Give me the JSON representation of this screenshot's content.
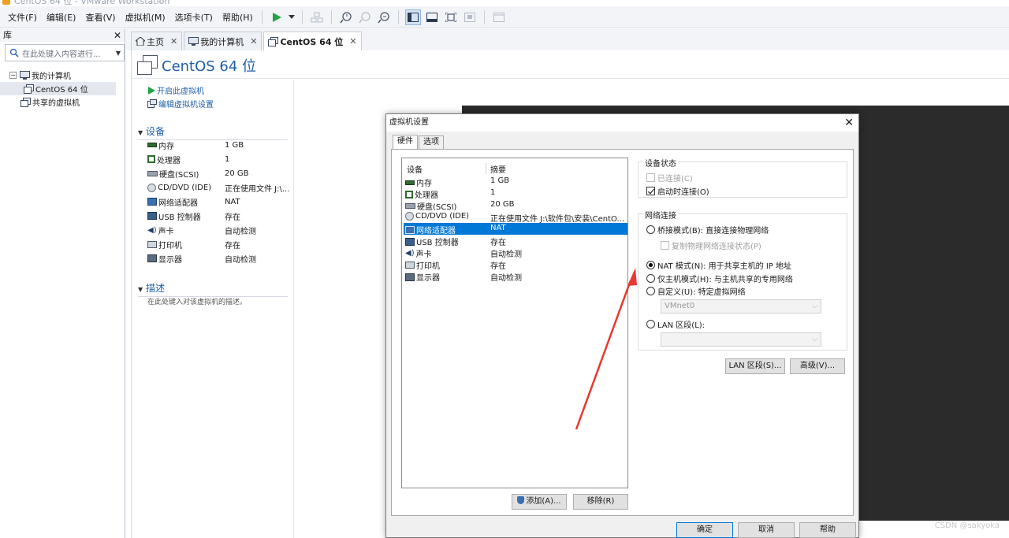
{
  "window": {
    "title": "CentOS 64 位 - VMware Workstation"
  },
  "menu": [
    "文件(F)",
    "编辑(E)",
    "查看(V)",
    "虚拟机(M)",
    "选项卡(T)",
    "帮助(H)"
  ],
  "library": {
    "header": "库",
    "search_placeholder": "在此处键入内容进行...",
    "tree": {
      "root": "我的计算机",
      "vm": "CentOS 64 位",
      "shared": "共享的虚拟机"
    }
  },
  "tabs": [
    {
      "label": "主页"
    },
    {
      "label": "我的计算机"
    },
    {
      "label": "CentOS 64 位"
    }
  ],
  "vm": {
    "title": "CentOS 64 位",
    "actions": {
      "power_on": "开启此虚拟机",
      "edit": "编辑虚拟机设置"
    },
    "devices_header": "设备",
    "devices": [
      {
        "name": "内存",
        "value": "1 GB",
        "icon": "memory-icon"
      },
      {
        "name": "处理器",
        "value": "1",
        "icon": "cpu-icon"
      },
      {
        "name": "硬盘(SCSI)",
        "value": "20 GB",
        "icon": "disk-icon"
      },
      {
        "name": "CD/DVD (IDE)",
        "value": "正在使用文件 J:\\...",
        "icon": "cd-icon"
      },
      {
        "name": "网络适配器",
        "value": "NAT",
        "icon": "network-icon"
      },
      {
        "name": "USB 控制器",
        "value": "存在",
        "icon": "usb-icon"
      },
      {
        "name": "声卡",
        "value": "自动检测",
        "icon": "sound-icon"
      },
      {
        "name": "打印机",
        "value": "存在",
        "icon": "printer-icon"
      },
      {
        "name": "显示器",
        "value": "自动检测",
        "icon": "display-icon"
      }
    ],
    "description_header": "描述",
    "description_placeholder": "在此处键入对该虚拟机的描述。"
  },
  "dialog": {
    "title": "虚拟机设置",
    "tabs": [
      "硬件",
      "选项"
    ],
    "list_headers": {
      "device": "设备",
      "summary": "摘要"
    },
    "list": [
      {
        "name": "内存",
        "value": "1 GB"
      },
      {
        "name": "处理器",
        "value": "1"
      },
      {
        "name": "硬盘(SCSI)",
        "value": "20 GB"
      },
      {
        "name": "CD/DVD (IDE)",
        "value": "正在使用文件 J:\\软件包\\安装\\CentO..."
      },
      {
        "name": "网络适配器",
        "value": "NAT",
        "selected": true
      },
      {
        "name": "USB 控制器",
        "value": "存在"
      },
      {
        "name": "声卡",
        "value": "自动检测"
      },
      {
        "name": "打印机",
        "value": "存在"
      },
      {
        "name": "显示器",
        "value": "自动检测"
      }
    ],
    "device_status": {
      "label": "设备状态",
      "connected": "已连接(C)",
      "connect_at_power_on": "启动时连接(O)"
    },
    "network": {
      "label": "网络连接",
      "bridged": "桥接模式(B): 直接连接物理网络",
      "replicate": "复制物理网络连接状态(P)",
      "nat": "NAT 模式(N): 用于共享主机的 IP 地址",
      "host_only": "仅主机模式(H): 与主机共享的专用网络",
      "custom": "自定义(U): 特定虚拟网络",
      "custom_value": "VMnet0",
      "lan": "LAN 区段(L):",
      "lan_value": ""
    },
    "buttons": {
      "lan_segments": "LAN 区段(S)...",
      "advanced": "高级(V)...",
      "add": "添加(A)...",
      "remove": "移除(R)",
      "ok": "确定",
      "cancel": "取消",
      "help": "帮助"
    }
  },
  "watermark": "CSDN @sakyoka",
  "colors": {
    "accent": "#0078d7",
    "link": "#1f5fa8",
    "arrow": "#e8382f"
  }
}
